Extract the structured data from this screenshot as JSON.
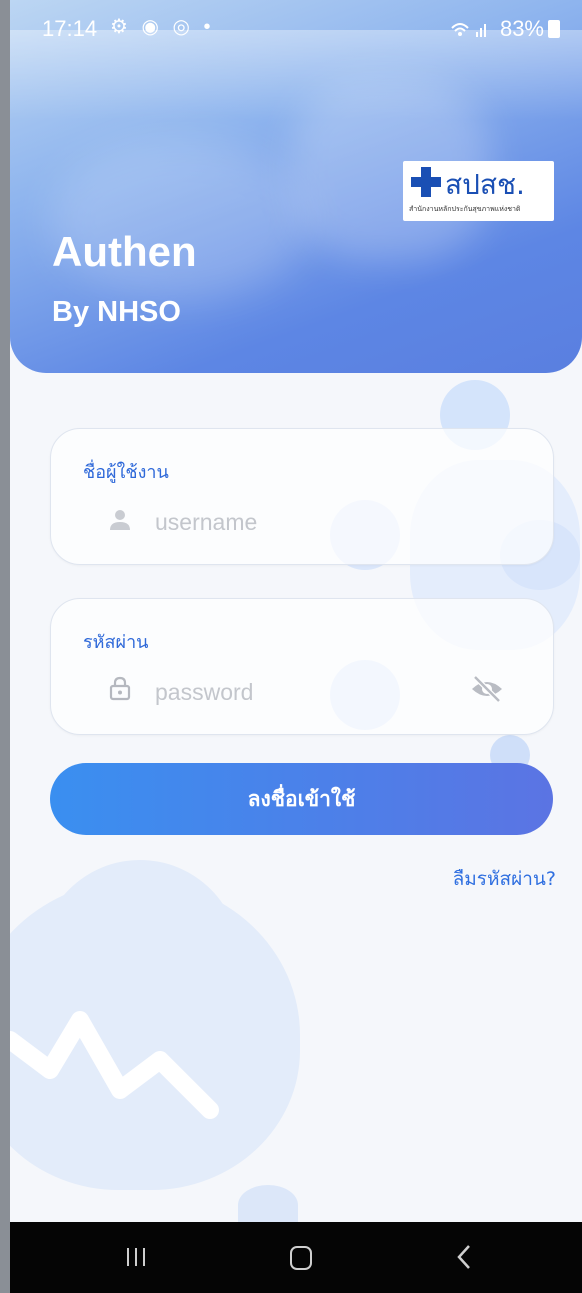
{
  "status_bar": {
    "time": "17:14",
    "left_icons": "⚙ ◉ ◎ •",
    "right": "83%"
  },
  "header": {
    "title": "Authen",
    "subtitle": "By NHSO",
    "logo_text": "สปสช.",
    "logo_caption": "สำนักงานหลักประกันสุขภาพแห่งชาติ"
  },
  "form": {
    "username_label": "ชื่อผู้ใช้งาน",
    "username_placeholder": "username",
    "username_value": "",
    "password_label": "รหัสผ่าน",
    "password_placeholder": "password",
    "password_value": "",
    "login_label": "ลงชื่อเข้าใช้",
    "forgot_label": "ลืมรหัสผ่าน?"
  },
  "icons": {
    "user": "user-icon",
    "lock": "lock-icon",
    "eye_off": "eye-off-icon"
  },
  "colors": {
    "accent": "#2f69d9",
    "button_start": "#3a8ff0",
    "button_end": "#5b74e3"
  }
}
